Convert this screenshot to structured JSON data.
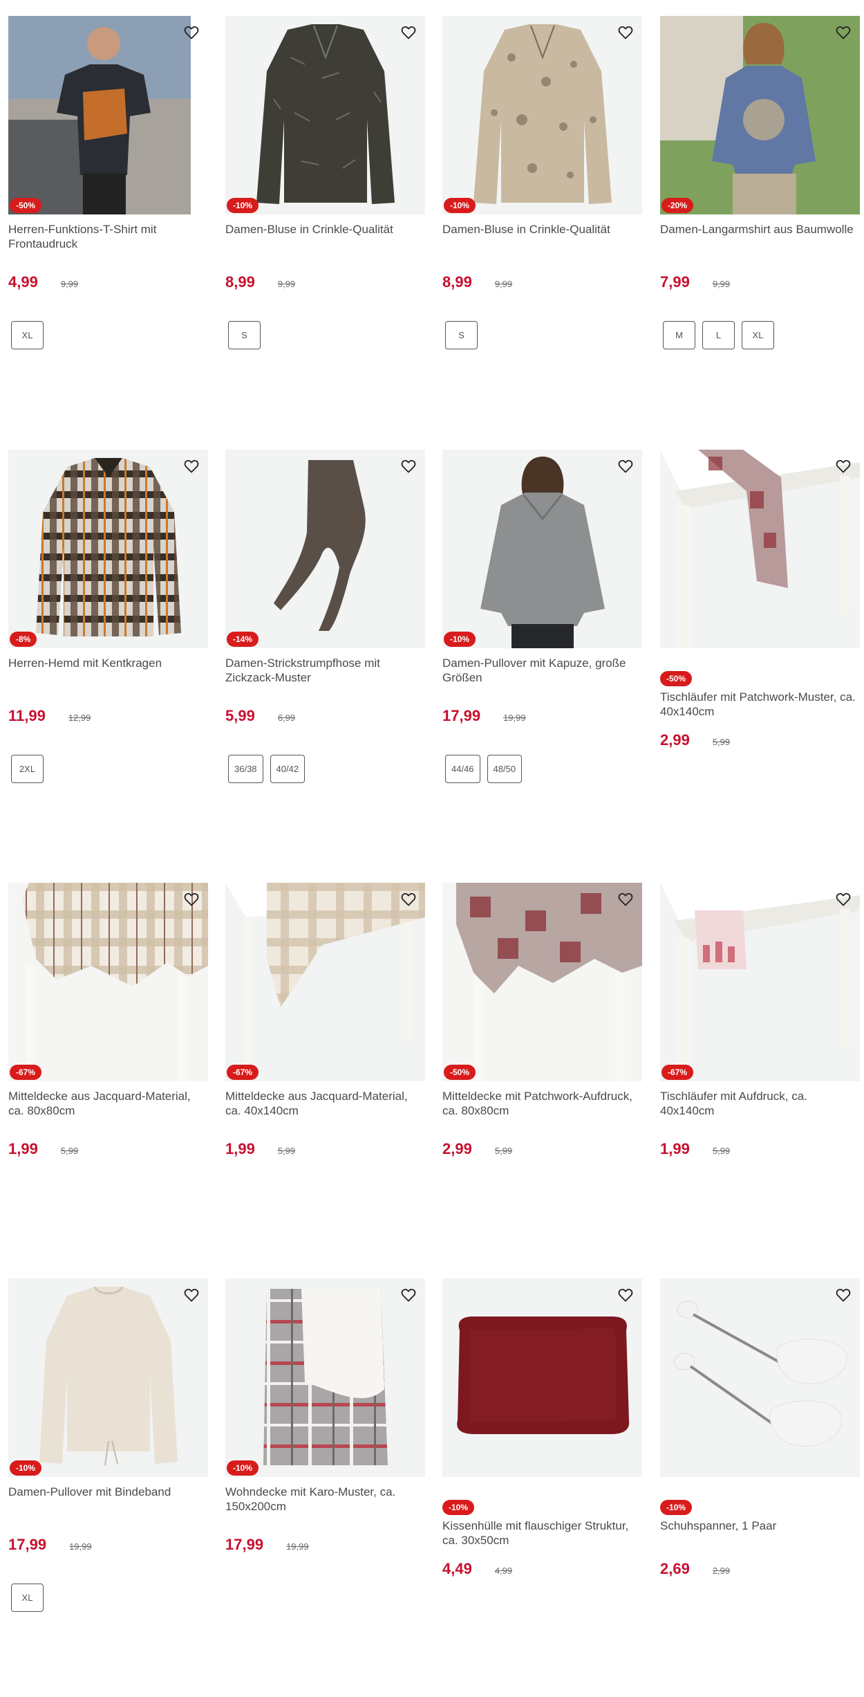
{
  "products": [
    {
      "name": "Herren-Funktions-T-Shirt mit Frontaudruck",
      "discount": "-50%",
      "price": "4,99",
      "old_price": "9,99",
      "sizes": [
        "XL"
      ],
      "image": "man-tshirt"
    },
    {
      "name": "Damen-Bluse in Crinkle-Qualität",
      "discount": "-10%",
      "price": "8,99",
      "old_price": "9,99",
      "sizes": [
        "S"
      ],
      "image": "dark-blouse"
    },
    {
      "name": "Damen-Bluse in Crinkle-Qualität",
      "discount": "-10%",
      "price": "8,99",
      "old_price": "9,99",
      "sizes": [
        "S"
      ],
      "image": "beige-blouse"
    },
    {
      "name": "Damen-Langarmshirt aus Baumwolle",
      "discount": "-20%",
      "price": "7,99",
      "old_price": "9,99",
      "sizes": [
        "M",
        "L",
        "XL"
      ],
      "image": "woman-longsleeve"
    },
    {
      "name": "Herren-Hemd mit Kentkragen",
      "discount": "-8%",
      "price": "11,99",
      "old_price": "12,99",
      "sizes": [
        "2XL"
      ],
      "image": "checked-shirt"
    },
    {
      "name": "Damen-Strickstrumpfhose mit Zickzack-Muster",
      "discount": "-14%",
      "price": "5,99",
      "old_price": "6,99",
      "sizes": [
        "36/38",
        "40/42"
      ],
      "image": "tights"
    },
    {
      "name": "Damen-Pullover mit Kapuze, große Größen",
      "discount": "-10%",
      "price": "17,99",
      "old_price": "19,99",
      "sizes": [
        "44/46",
        "48/50"
      ],
      "image": "grey-hoodie"
    },
    {
      "name": "Tischläufer mit Patchwork-Muster, ca. 40x140cm",
      "discount": "-50%",
      "price": "2,99",
      "old_price": "5,99",
      "sizes": [],
      "image": "patchwork-runner",
      "badge_below": true
    },
    {
      "name": "Mitteldecke aus Jacquard-Material, ca. 80x80cm",
      "discount": "-67%",
      "price": "1,99",
      "old_price": "5,99",
      "sizes": [],
      "image": "plaid-tablecloth"
    },
    {
      "name": "Mitteldecke aus Jacquard-Material, ca. 40x140cm",
      "discount": "-67%",
      "price": "1,99",
      "old_price": "5,99",
      "sizes": [],
      "image": "plaid-runner"
    },
    {
      "name": "Mitteldecke mit Patchwork-Aufdruck, ca. 80x80cm",
      "discount": "-50%",
      "price": "2,99",
      "old_price": "5,99",
      "sizes": [],
      "image": "patchwork-tablecloth"
    },
    {
      "name": "Tischläufer mit Aufdruck, ca. 40x140cm",
      "discount": "-67%",
      "price": "1,99",
      "old_price": "5,99",
      "sizes": [],
      "image": "printed-runner"
    },
    {
      "name": "Damen-Pullover mit Bindeband",
      "discount": "-10%",
      "price": "17,99",
      "old_price": "19,99",
      "sizes": [
        "XL"
      ],
      "image": "cream-pullover"
    },
    {
      "name": "Wohndecke mit Karo-Muster, ca. 150x200cm",
      "discount": "-10%",
      "price": "17,99",
      "old_price": "19,99",
      "sizes": [],
      "image": "check-blanket"
    },
    {
      "name": "Kissenhülle mit flauschiger Struktur, ca. 30x50cm",
      "discount": "-10%",
      "price": "4,49",
      "old_price": "4,99",
      "sizes": [],
      "image": "red-cushion",
      "badge_below": true
    },
    {
      "name": "Schuhspanner, 1 Paar",
      "discount": "-10%",
      "price": "2,69",
      "old_price": "2,99",
      "sizes": [],
      "image": "shoe-trees",
      "badge_below": true
    }
  ],
  "colors": {
    "accent": "#d81b1b",
    "price": "#c8102e"
  },
  "icons": {
    "wishlist": "heart-outline-icon"
  }
}
